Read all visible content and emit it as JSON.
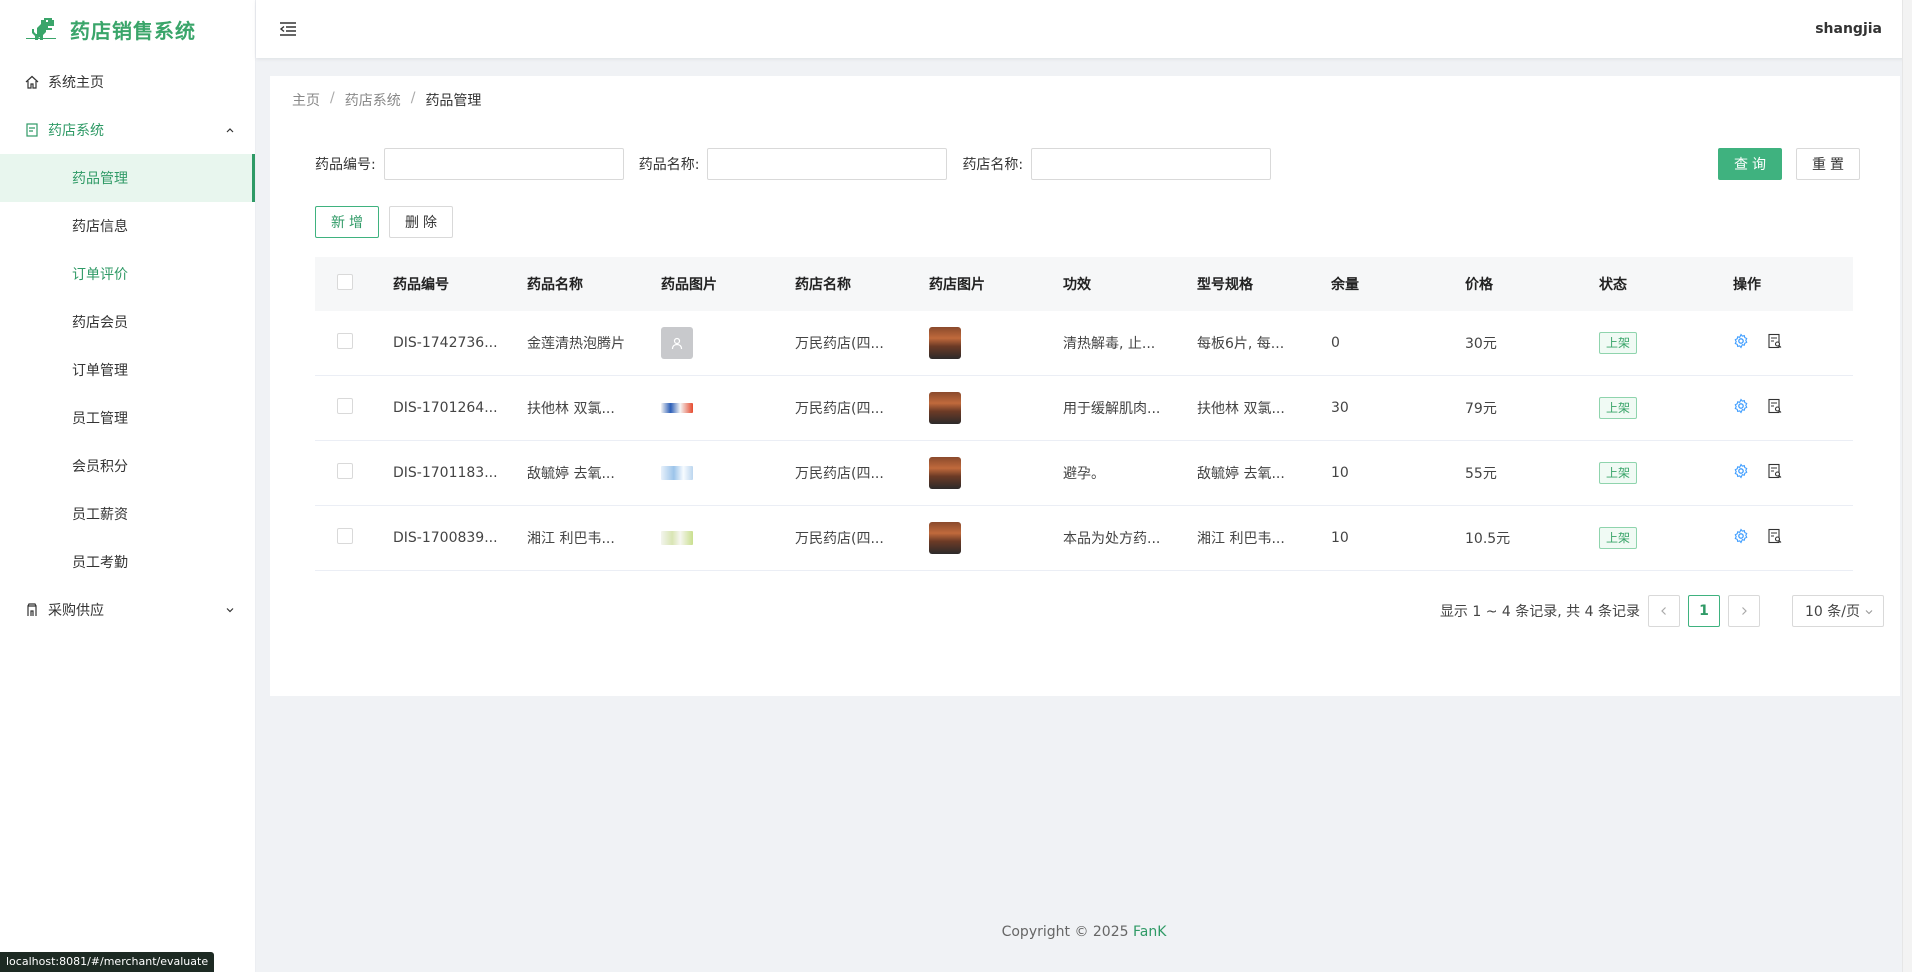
{
  "app": {
    "title": "药店销售系统",
    "user": "shangjia"
  },
  "sidebar": {
    "home": "系统主页",
    "group_pharmacy": "药店系统",
    "sub_items": [
      "药品管理",
      "药店信息",
      "订单评价",
      "药店会员",
      "订单管理",
      "员工管理",
      "会员积分",
      "员工薪资",
      "员工考勤"
    ],
    "group_purchase": "采购供应"
  },
  "breadcrumb": {
    "home": "主页",
    "sep": "/",
    "section": "药店系统",
    "current": "药品管理"
  },
  "search": {
    "code_label": "药品编号:",
    "name_label": "药品名称:",
    "store_label": "药店名称:",
    "query_btn": "查询",
    "reset_btn": "重置"
  },
  "actions": {
    "add": "新增",
    "delete": "删除"
  },
  "table": {
    "headers": [
      "药品编号",
      "药品名称",
      "药品图片",
      "药店名称",
      "药店图片",
      "功效",
      "型号规格",
      "余量",
      "价格",
      "状态",
      "操作"
    ],
    "rows": [
      {
        "code": "DIS-1742736...",
        "name": "金莲清热泡腾片",
        "img": "placeholder",
        "store": "万民药店(四...",
        "effect": "清热解毒, 止...",
        "spec": "每板6片, 每...",
        "stock": "0",
        "price": "30元",
        "status": "上架"
      },
      {
        "code": "DIS-1701264...",
        "name": "扶他林 双氯...",
        "img": "box-blue",
        "store": "万民药店(四...",
        "effect": "用于缓解肌肉...",
        "spec": "扶他林 双氯...",
        "stock": "30",
        "price": "79元",
        "status": "上架"
      },
      {
        "code": "DIS-1701183...",
        "name": "敌毓婷 去氧...",
        "img": "box-light",
        "store": "万民药店(四...",
        "effect": "避孕。",
        "spec": "敌毓婷 去氧...",
        "stock": "10",
        "price": "55元",
        "status": "上架"
      },
      {
        "code": "DIS-1700839...",
        "name": "湘江 利巴韦...",
        "img": "box-green",
        "store": "万民药店(四...",
        "effect": "本品为处方药...",
        "spec": "湘江 利巴韦...",
        "stock": "10",
        "price": "10.5元",
        "status": "上架"
      }
    ]
  },
  "pagination": {
    "summary": "显示 1 ~ 4 条记录, 共 4 条记录",
    "current_page": "1",
    "page_size": "10 条/页"
  },
  "footer": {
    "copyright": "Copyright © 2025",
    "brand": "FanK"
  },
  "statusbar": {
    "url": "localhost:8081/#/merchant/evaluate"
  },
  "colors": {
    "accent": "#3fb27f",
    "accent_text": "#2f9a66",
    "icon_blue": "#409eff"
  }
}
